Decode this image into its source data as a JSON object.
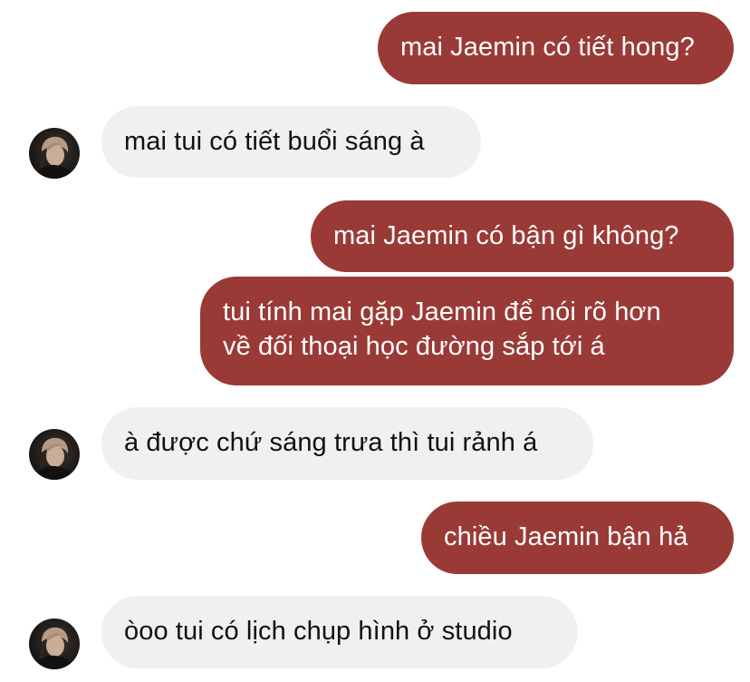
{
  "conversation": {
    "messages": [
      {
        "direction": "outgoing",
        "text": "mai Jaemin có tiết hong?"
      },
      {
        "direction": "incoming",
        "text": "mai tui có tiết buổi sáng à"
      },
      {
        "direction": "outgoing",
        "text": "mai Jaemin có bận gì không?"
      },
      {
        "direction": "outgoing",
        "lines": [
          "tui tính mai gặp Jaemin để nói rõ hơn",
          "về đối thoại học đường sắp tới á"
        ]
      },
      {
        "direction": "incoming",
        "text": "à được chứ sáng trưa thì tui rảnh á"
      },
      {
        "direction": "outgoing",
        "text": "chiều Jaemin bận hả"
      },
      {
        "direction": "incoming",
        "text": "òoo tui có lịch chụp hình ở studio"
      }
    ]
  },
  "colors": {
    "outgoing_bubble": "#9a3a36",
    "incoming_bubble": "#f0f0f2",
    "outgoing_text": "#ffffff",
    "incoming_text": "#111111"
  },
  "icons": {
    "avatar": "contact-avatar-photo"
  }
}
